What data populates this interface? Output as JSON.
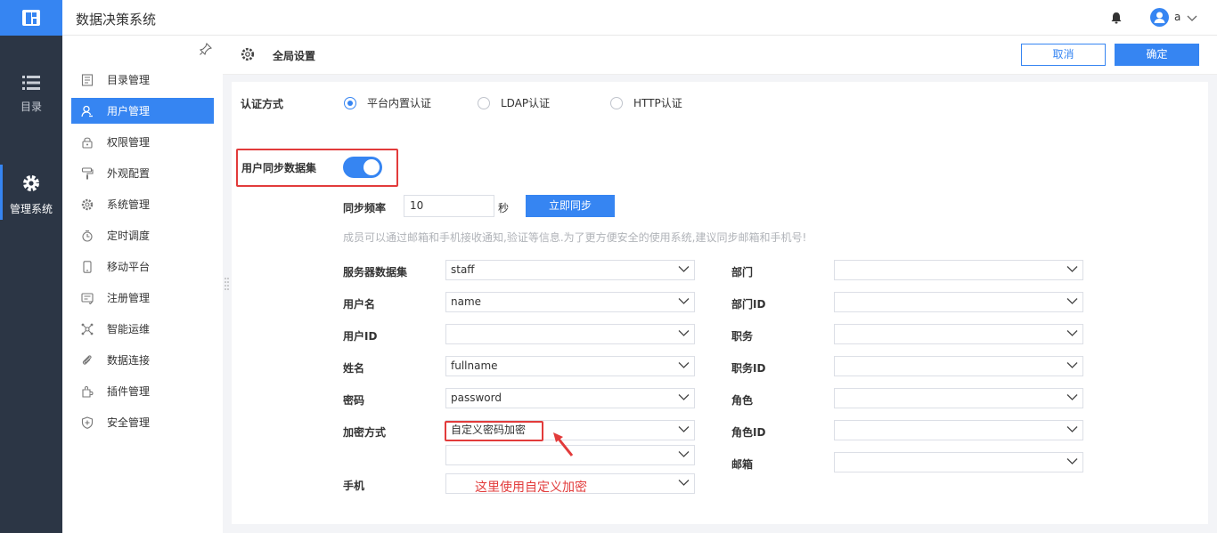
{
  "app": {
    "title": "数据决策系统"
  },
  "user": {
    "name": "a"
  },
  "leftnav": {
    "items": [
      {
        "label": "目录"
      },
      {
        "label": "管理系统"
      }
    ]
  },
  "sidebar": {
    "items": [
      {
        "label": "目录管理",
        "icon": "directory-icon"
      },
      {
        "label": "用户管理",
        "icon": "user-icon"
      },
      {
        "label": "权限管理",
        "icon": "lock-icon"
      },
      {
        "label": "外观配置",
        "icon": "paint-roller-icon"
      },
      {
        "label": "系统管理",
        "icon": "gear-icon"
      },
      {
        "label": "定时调度",
        "icon": "timer-icon"
      },
      {
        "label": "移动平台",
        "icon": "mobile-icon"
      },
      {
        "label": "注册管理",
        "icon": "register-icon"
      },
      {
        "label": "智能运维",
        "icon": "ops-icon"
      },
      {
        "label": "数据连接",
        "icon": "link-icon"
      },
      {
        "label": "插件管理",
        "icon": "plugin-icon"
      },
      {
        "label": "安全管理",
        "icon": "shield-icon"
      }
    ],
    "active_index": 1
  },
  "header": {
    "title": "全局设置",
    "cancel_label": "取消",
    "ok_label": "确定"
  },
  "auth": {
    "label": "认证方式",
    "options": [
      "平台内置认证",
      "LDAP认证",
      "HTTP认证"
    ],
    "selected_index": 0
  },
  "sync": {
    "label": "用户同步数据集",
    "enabled": true,
    "freq_label": "同步频率",
    "freq_value": "10",
    "unit": "秒",
    "sync_now_label": "立即同步",
    "hint": "成员可以通过邮箱和手机接收通知,验证等信息.为了更方便安全的使用系统,建议同步邮箱和手机号!"
  },
  "fields_left": [
    {
      "label": "服务器数据集",
      "value": "staff"
    },
    {
      "label": "用户名",
      "value": "name"
    },
    {
      "label": "用户ID",
      "value": ""
    },
    {
      "label": "姓名",
      "value": "fullname"
    },
    {
      "label": "密码",
      "value": "password"
    },
    {
      "label": "加密方式",
      "value": "自定义密码加密"
    },
    {
      "label": "",
      "value": ""
    },
    {
      "label": "手机",
      "value": ""
    }
  ],
  "fields_right": [
    {
      "label": "部门",
      "value": ""
    },
    {
      "label": "部门ID",
      "value": ""
    },
    {
      "label": "职务",
      "value": ""
    },
    {
      "label": "职务ID",
      "value": ""
    },
    {
      "label": "角色",
      "value": ""
    },
    {
      "label": "角色ID",
      "value": ""
    },
    {
      "label": "邮箱",
      "value": ""
    }
  ],
  "annotation": {
    "text": "这里使用自定义加密"
  },
  "colors": {
    "accent": "#3685f2",
    "nav_bg": "#2c3645",
    "annotation": "#e23b3b"
  }
}
